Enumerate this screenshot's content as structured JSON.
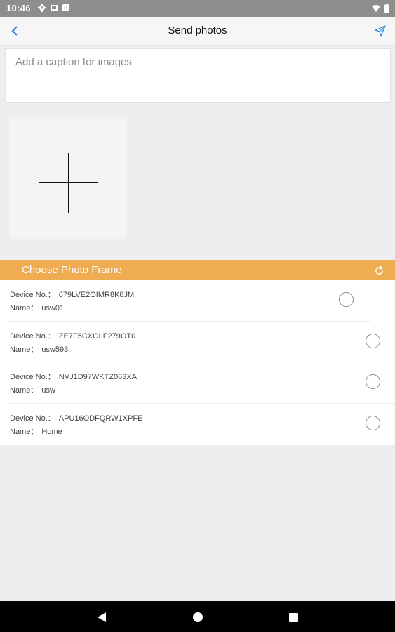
{
  "status_bar": {
    "time": "10:46",
    "left_icons": [
      "gear-icon",
      "sim-card-icon",
      "data-saver-icon"
    ],
    "right_icons": [
      "wifi-icon",
      "battery-icon"
    ]
  },
  "app_bar": {
    "title": "Send photos",
    "back_icon": "chevron-left-icon",
    "send_icon": "send-icon",
    "accent_color": "#2f7fd9"
  },
  "caption": {
    "placeholder": "Add a caption for images",
    "value": ""
  },
  "add_photo": {
    "icon": "plus-icon"
  },
  "frame_section": {
    "title": "Choose Photo Frame",
    "refresh_icon": "refresh-icon",
    "header_color": "#f0ac51"
  },
  "devices": [
    {
      "device_label": "Device No.：",
      "device_no": "679LVE2OIMR8K8JM",
      "name_label": "Name：",
      "name": "usw01",
      "selected": false
    },
    {
      "device_label": "Device No.：",
      "device_no": "ZE7F5CXOLF279OT0",
      "name_label": "Name：",
      "name": "usw593",
      "selected": false
    },
    {
      "device_label": "Device No.：",
      "device_no": "NVJ1D97WKTZ063XA",
      "name_label": "Name：",
      "name": "usw",
      "selected": false
    },
    {
      "device_label": "Device No.：",
      "device_no": "APU16ODFQRW1XPFE",
      "name_label": "Name：",
      "name": "Home",
      "selected": false
    }
  ],
  "nav_bar": {
    "icons": [
      "back-triangle-icon",
      "home-circle-icon",
      "recents-square-icon"
    ]
  }
}
